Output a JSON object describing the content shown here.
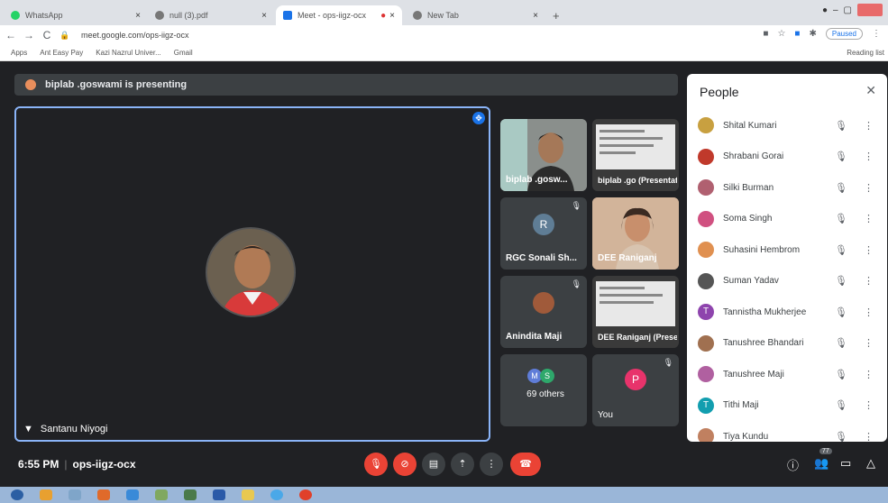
{
  "browser": {
    "tabs": [
      {
        "title": "WhatsApp",
        "color": "#25d366"
      },
      {
        "title": "null (3).pdf",
        "color": "#777777"
      },
      {
        "title": "Meet - ops-iigz-ocx",
        "color": "#1a73e8"
      },
      {
        "title": "New Tab",
        "color": "#777777"
      }
    ],
    "url": "meet.google.com/ops-iigz-ocx",
    "paused_label": "Paused",
    "bookmarks": [
      "Apps",
      "Ant Easy Pay",
      "Kazi Nazrul Univer...",
      "Gmail"
    ],
    "reading_list": "Reading list"
  },
  "meet": {
    "presenting_banner": "biplab .goswami is presenting",
    "main_speaker": "Santanu Niyogi",
    "tiles": [
      {
        "name": "biplab .gosw...",
        "kind": "video"
      },
      {
        "name": "biplab .go (Presentati...",
        "kind": "screen"
      },
      {
        "name": "RGC Sonali Sh...",
        "letter": "R",
        "color": "#5f7d95",
        "kind": "letter"
      },
      {
        "name": "DEE Raniganj",
        "kind": "video2"
      },
      {
        "name": "Anindita Maji",
        "kind": "avatar"
      },
      {
        "name": "DEE Raniganj (Presentation)",
        "kind": "screen"
      },
      {
        "name": "69 others",
        "kind": "others"
      },
      {
        "name": "You",
        "letter": "P",
        "color": "#e8336b",
        "kind": "letter"
      }
    ],
    "time": "6:55 PM",
    "meeting_code": "ops-iigz-ocx",
    "participant_count": "77"
  },
  "people": {
    "title": "People",
    "list": [
      {
        "name": "Shital Kumari",
        "color": "#c8a040",
        "letter": ""
      },
      {
        "name": "Shrabani Gorai",
        "color": "#c0392b",
        "letter": ""
      },
      {
        "name": "Silki Burman",
        "color": "#b06070",
        "letter": ""
      },
      {
        "name": "Soma Singh",
        "color": "#d05080",
        "letter": ""
      },
      {
        "name": "Suhasini Hembrom",
        "color": "#e09050",
        "letter": ""
      },
      {
        "name": "Suman Yadav",
        "color": "#555555",
        "letter": ""
      },
      {
        "name": "Tannistha Mukherjee",
        "color": "#8e44ad",
        "letter": "T"
      },
      {
        "name": "Tanushree Bhandari",
        "color": "#a07050",
        "letter": ""
      },
      {
        "name": "Tanushree Maji",
        "color": "#b060a0",
        "letter": ""
      },
      {
        "name": "Tithi Maji",
        "color": "#129eaf",
        "letter": "T"
      },
      {
        "name": "Tiya Kundu",
        "color": "#c08060",
        "letter": ""
      }
    ]
  }
}
